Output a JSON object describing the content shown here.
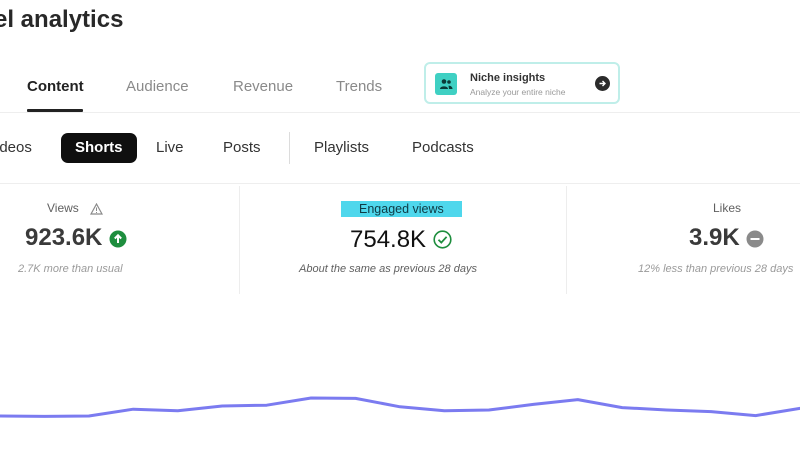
{
  "header": {
    "title": "el analytics"
  },
  "main_tabs": [
    {
      "label": "Content",
      "active": true
    },
    {
      "label": "Audience",
      "active": false
    },
    {
      "label": "Revenue",
      "active": false
    },
    {
      "label": "Trends",
      "active": false
    }
  ],
  "niche_card": {
    "title": "Niche insights",
    "subtitle": "Analyze your entire niche",
    "icon": "people-icon",
    "action_icon": "arrow-right-icon"
  },
  "content_chips": [
    {
      "label": "ideos",
      "selected": false
    },
    {
      "label": "Shorts",
      "selected": true
    },
    {
      "label": "Live",
      "selected": false
    },
    {
      "label": "Posts",
      "selected": false
    },
    {
      "label": "Playlists",
      "selected": false
    },
    {
      "label": "Podcasts",
      "selected": false
    }
  ],
  "metrics": [
    {
      "label": "Views",
      "value": "923.6K",
      "note": "2.7K more than usual",
      "label_icon": "warning-icon",
      "status_icon": "arrow-up-circle-icon",
      "status_color": "#1e8e3e"
    },
    {
      "label": "Engaged views",
      "value": "754.8K",
      "note": "About the same as previous 28 days",
      "status_icon": "check-circle-icon",
      "status_color": "#1e8e3e",
      "highlight_color": "#4fd7ec"
    },
    {
      "label": "Likes",
      "value": "3.9K",
      "note": "12% less than previous 28 days",
      "status_icon": "minus-circle-icon",
      "status_color": "#8a8a8a"
    }
  ],
  "chart_data": {
    "type": "line",
    "series_color": "#7b7bf0",
    "values": [
      0.35,
      0.34,
      0.35,
      0.52,
      0.48,
      0.6,
      0.62,
      0.8,
      0.79,
      0.58,
      0.48,
      0.5,
      0.64,
      0.76,
      0.56,
      0.5,
      0.46,
      0.36,
      0.54
    ]
  }
}
